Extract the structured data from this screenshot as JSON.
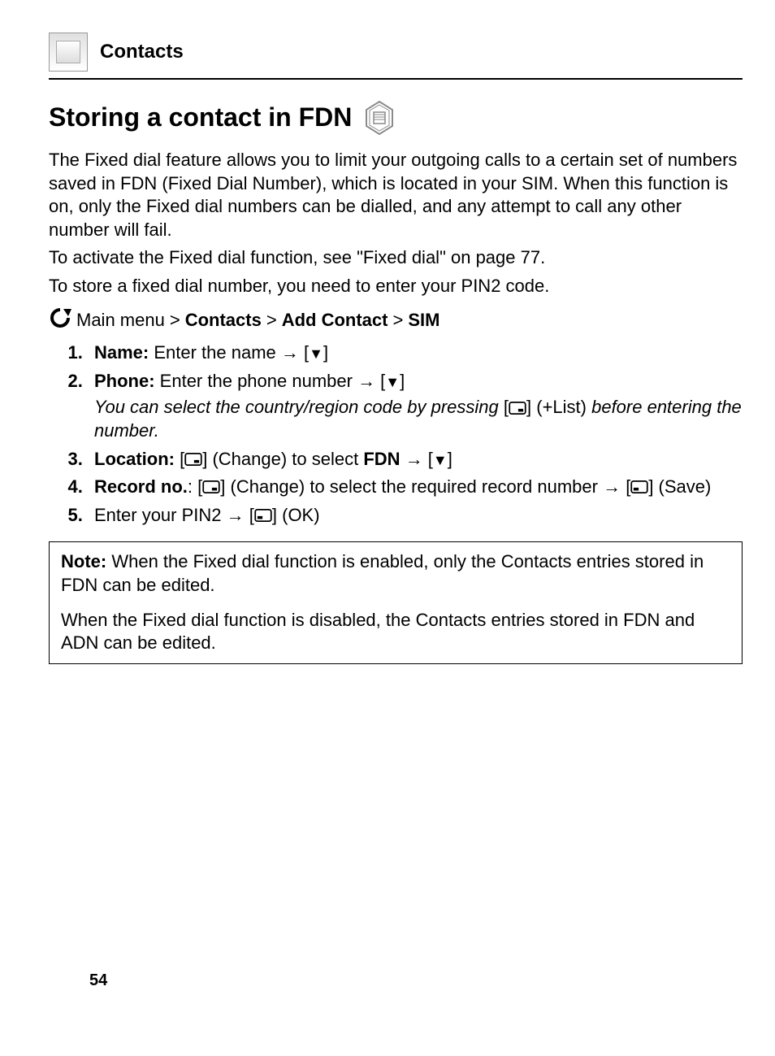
{
  "header": {
    "section": "Contacts"
  },
  "title": "Storing a contact in FDN",
  "intro": {
    "p1": "The Fixed dial feature allows you to limit your outgoing calls to a certain set of numbers saved in FDN (Fixed Dial Number), which is located in your SIM. When this function is on, only the Fixed dial numbers can be dialled, and any attempt to call any other number will fail.",
    "p2": "To activate the Fixed dial function, see \"Fixed dial\" on page 77.",
    "p3": "To store a fixed dial number, you need to enter your PIN2 code."
  },
  "breadcrumb": {
    "prefix": "Main menu",
    "sep": ">",
    "items": [
      "Contacts",
      "Add Contact",
      "SIM"
    ]
  },
  "steps": {
    "s1": {
      "label": "Name:",
      "text": " Enter the name "
    },
    "s2": {
      "label": "Phone:",
      "text": " Enter the phone number ",
      "note_a": "You can select the country/region code by pressing ",
      "note_after": " (+List) ",
      "note_b": "before entering the number."
    },
    "s3": {
      "label": "Location:",
      "text_mid": " (Change) to select ",
      "fdn": "FDN"
    },
    "s4": {
      "label": "Record no.",
      "text_a": ": ",
      "text_mid": " (Change) to select the required record number ",
      "save": " (Save)"
    },
    "s5": {
      "text_a": "Enter your PIN2 ",
      "ok": " (OK)"
    }
  },
  "note": {
    "label": "Note:",
    "p1": " When the Fixed dial function is enabled, only the Contacts entries stored in FDN can be edited.",
    "p2": "When the Fixed dial function is disabled, the Contacts entries stored in FDN and ADN can be edited."
  },
  "page_number": "54"
}
